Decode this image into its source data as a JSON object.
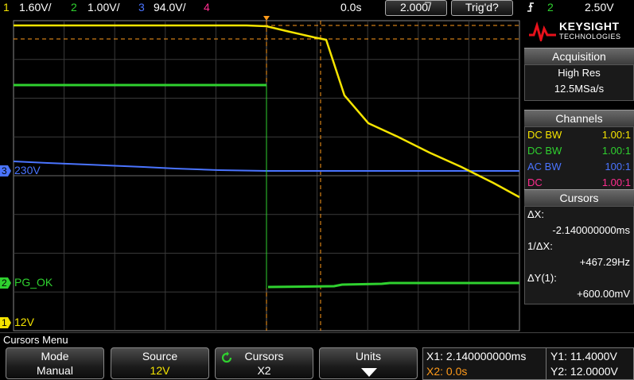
{
  "topbar": {
    "ch1_num": "1",
    "ch1_scale": "1.60V/",
    "ch2_num": "2",
    "ch2_scale": "1.00V/",
    "ch3_num": "3",
    "ch3_scale": "94.0V/",
    "ch4_num": "4",
    "time_offset": "0.0s",
    "timebase": "2.000̅/",
    "trig_status": "Trig'd?",
    "trig_icon": "trigger-edge-icon",
    "trig_src": "2",
    "trig_level": "2.50V"
  },
  "screen": {
    "ch3_label": "3",
    "ch3_marker": "230V",
    "ch2_label": "2",
    "ch2_marker": "PG_OK",
    "ch1_label": "1",
    "ch1_marker": "12V"
  },
  "panel": {
    "brand": "KEYSIGHT",
    "brand_sub": "TECHNOLOGIES",
    "acq_title": "Acquisition",
    "acq_mode": "High Res",
    "acq_rate": "12.5MSa/s",
    "channels_title": "Channels",
    "channels": [
      {
        "coupling": "DC BW",
        "probe": "1.00:1",
        "color": "#f5e400"
      },
      {
        "coupling": "DC BW",
        "probe": "1.00:1",
        "color": "#2fd12f"
      },
      {
        "coupling": "AC BW",
        "probe": "100:1",
        "color": "#4a74ff"
      },
      {
        "coupling": "DC",
        "probe": "1.00:1",
        "color": "#ff2d8f"
      }
    ],
    "cursors_title": "Cursors",
    "dx_label": "ΔX:",
    "dx_value": "-2.140000000ms",
    "inv_dx_label": "1/ΔX:",
    "inv_dx_value": "+467.29Hz",
    "dy_label": "ΔY(1):",
    "dy_value": "+600.00mV"
  },
  "menu": {
    "title": "Cursors Menu",
    "keys": [
      {
        "title": "Mode",
        "value": "Manual"
      },
      {
        "title": "Source",
        "value": "12V"
      },
      {
        "title": "Cursors",
        "value": "X2"
      },
      {
        "title": "Units",
        "value": ""
      }
    ]
  },
  "readout": {
    "x1": "X1: 2.140000000ms",
    "x2": "X2: 0.0s",
    "y1": "Y1: 11.4000V",
    "y2": "Y2: 12.0000V"
  },
  "colors": {
    "ch1": "#f5e400",
    "ch2": "#2fd12f",
    "ch3": "#4a74ff",
    "ch4": "#ff2d8f",
    "cursor": "#ff9a1a"
  }
}
